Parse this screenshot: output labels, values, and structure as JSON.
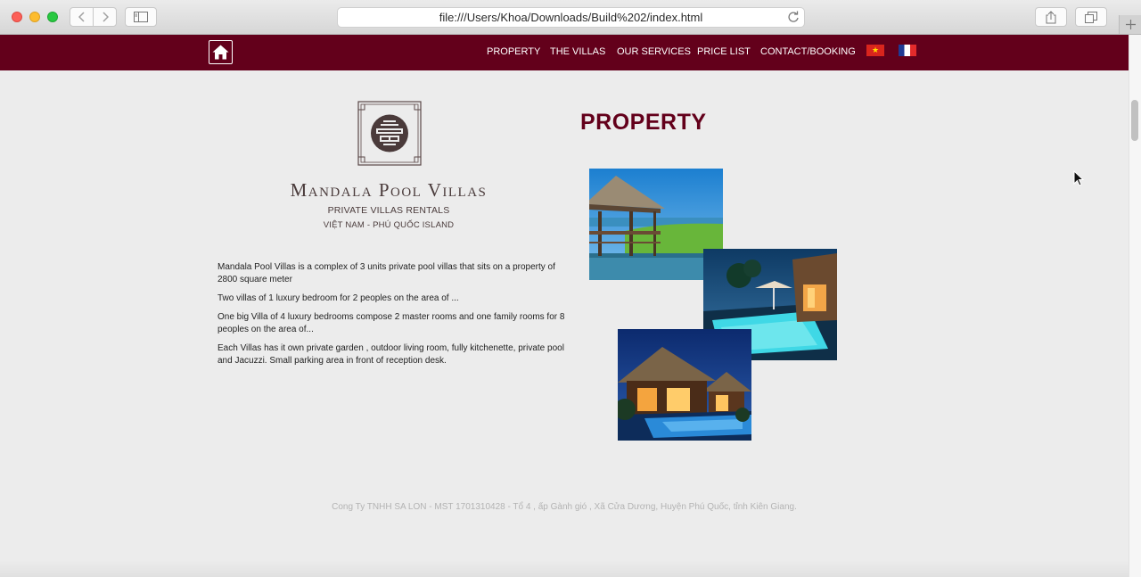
{
  "browser": {
    "url": "file:///Users/Khoa/Downloads/Build%202/index.html"
  },
  "nav": {
    "items": [
      "PROPERTY",
      "THE VILLAS",
      "OUR SERVICES",
      "PRICE LIST",
      "CONTACT/BOOKING"
    ],
    "icons": [
      "home-icon",
      "flag-vietnam-icon",
      "flag-france-icon"
    ]
  },
  "brand": {
    "name": "Mandala Pool Villas",
    "subtitle": "PRIVATE VILLAS RENTALS",
    "location": "VIỆT NAM - PHÚ QUỐC ISLAND"
  },
  "intro": {
    "paragraphs": [
      "Mandala Pool Villas is a complex of 3 units private pool villas that sits on a property of 2800 square meter",
      "Two villas of 1 luxury bedroom for 2 peoples on the area of ...",
      "One big Villa of 4 luxury bedrooms compose 2 master rooms and one family rooms for 8 peoples on the area of...",
      "Each Villas has it own private garden , outdoor living room, fully kitchenette, private pool and Jacuzzi. Small parking area in front of reception desk."
    ]
  },
  "section": {
    "title": "PROPERTY"
  },
  "footer": {
    "text": "Cong Ty TNHH SA LON - MST 1701310428 - Tổ 4 , ấp Gành gió , Xã Cửa Dương, Huyện Phú Quốc, tỉnh Kiên Giang."
  },
  "colors": {
    "brand": "#63001b",
    "background": "#ececec"
  }
}
